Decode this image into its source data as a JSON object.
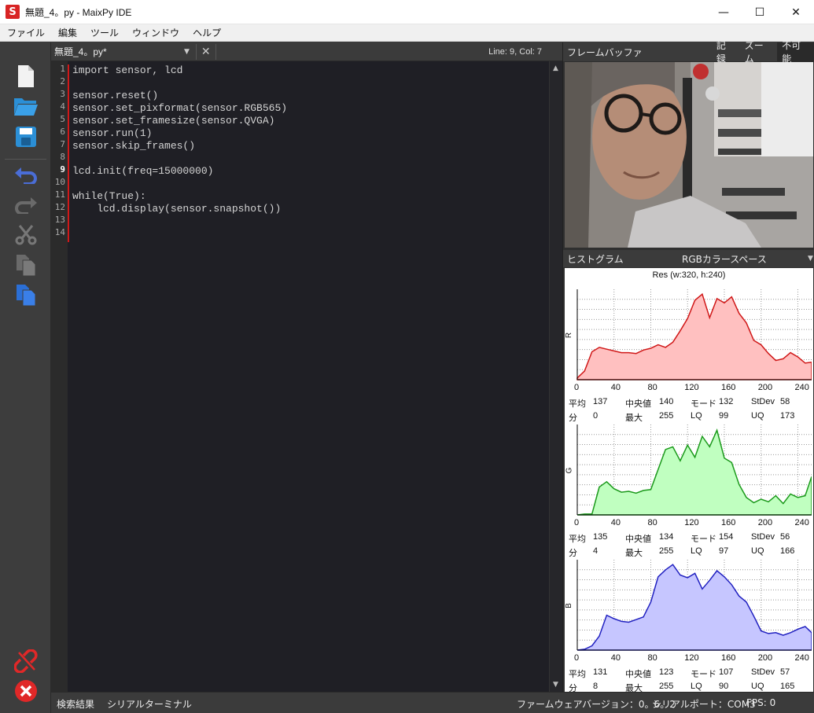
{
  "window": {
    "title": "無題_4。py - MaixPy IDE",
    "app_icon": "S",
    "minimize": "—",
    "maximize": "☐",
    "close": "✕"
  },
  "menu": [
    "ファイル",
    "編集",
    "ツール",
    "ウィンドウ",
    "ヘルプ"
  ],
  "toolbar": {
    "icons": [
      "new-file-icon",
      "open-folder-icon",
      "save-icon",
      "undo-icon",
      "redo-icon",
      "cut-icon",
      "copy-icon",
      "paste-icon",
      "disconnect-icon",
      "stop-icon"
    ]
  },
  "editor": {
    "tab_name": "無題_4。py*",
    "cursor_position": "Line: 9, Col: 7",
    "active_line": 9,
    "lines": [
      "import sensor, lcd",
      "",
      "sensor.reset()",
      "sensor.set_pixformat(sensor.RGB565)",
      "sensor.set_framesize(sensor.QVGA)",
      "sensor.run(1)",
      "sensor.skip_frames()",
      "",
      "lcd.init(freq=15000000)",
      "",
      "while(True):",
      "    lcd.display(sensor.snapshot())",
      "",
      ""
    ]
  },
  "framebuffer": {
    "label": "フレームバッファ",
    "buttons": [
      "記録",
      "ズーム",
      "不可能"
    ],
    "active_button": "不可能"
  },
  "histogram": {
    "label": "ヒストグラム",
    "color_space": "RGBカラースペース",
    "resolution": "Res (w:320, h:240)",
    "x_ticks": [
      "0",
      "40",
      "80",
      "120",
      "160",
      "200",
      "240"
    ],
    "stat_labels": {
      "mean": "平均",
      "median": "中央値",
      "mode": "モード",
      "stdev": "StDev",
      "min": "分",
      "max": "最大",
      "lq": "LQ",
      "uq": "UQ"
    },
    "channels": [
      {
        "name": "R",
        "color": "#ffc0c0",
        "stroke": "#d01818",
        "mean": "137",
        "median": "140",
        "mode": "132",
        "stdev": "58",
        "min": "0",
        "max": "255",
        "lq": "99",
        "uq": "173"
      },
      {
        "name": "G",
        "color": "#c0ffc0",
        "stroke": "#1a9a1a",
        "mean": "135",
        "median": "134",
        "mode": "154",
        "stdev": "56",
        "min": "4",
        "max": "255",
        "lq": "97",
        "uq": "166"
      },
      {
        "name": "B",
        "color": "#c6c6ff",
        "stroke": "#2020c0",
        "mean": "131",
        "median": "123",
        "mode": "107",
        "stdev": "57",
        "min": "8",
        "max": "255",
        "lq": "90",
        "uq": "165"
      }
    ]
  },
  "chart_data": [
    {
      "type": "area",
      "ylabel": "R",
      "x": [
        0,
        8,
        16,
        24,
        32,
        40,
        48,
        56,
        64,
        72,
        80,
        88,
        96,
        104,
        112,
        120,
        128,
        136,
        144,
        152,
        160,
        168,
        176,
        184,
        192,
        200,
        208,
        216,
        224,
        232,
        240,
        248,
        255
      ],
      "y": [
        2,
        10,
        32,
        37,
        35,
        33,
        31,
        31,
        30,
        34,
        36,
        40,
        37,
        43,
        56,
        70,
        91,
        98,
        71,
        93,
        88,
        95,
        76,
        65,
        45,
        40,
        30,
        22,
        24,
        31,
        26,
        19,
        20
      ]
    },
    {
      "type": "area",
      "ylabel": "G",
      "x": [
        0,
        8,
        16,
        24,
        32,
        40,
        48,
        56,
        64,
        72,
        80,
        88,
        96,
        104,
        112,
        120,
        128,
        136,
        144,
        152,
        160,
        168,
        176,
        184,
        192,
        200,
        208,
        216,
        224,
        232,
        240,
        248,
        255
      ],
      "y": [
        0,
        1,
        1,
        32,
        38,
        30,
        26,
        27,
        25,
        28,
        29,
        52,
        75,
        78,
        62,
        80,
        66,
        90,
        78,
        97,
        65,
        60,
        35,
        20,
        14,
        18,
        15,
        22,
        13,
        24,
        20,
        22,
        44
      ]
    },
    {
      "type": "area",
      "ylabel": "B",
      "x": [
        0,
        8,
        16,
        24,
        32,
        40,
        48,
        56,
        64,
        72,
        80,
        88,
        96,
        104,
        112,
        120,
        128,
        136,
        144,
        152,
        160,
        168,
        176,
        184,
        192,
        200,
        208,
        216,
        224,
        232,
        240,
        248,
        255
      ],
      "y": [
        0,
        1,
        5,
        16,
        40,
        36,
        33,
        32,
        35,
        38,
        55,
        84,
        92,
        98,
        86,
        83,
        88,
        70,
        80,
        91,
        84,
        75,
        62,
        55,
        39,
        22,
        19,
        20,
        17,
        20,
        24,
        27,
        20
      ]
    }
  ],
  "statusbar": {
    "search_results": "検索結果",
    "serial_terminal": "シリアルターミナル",
    "firmware": "ファームウェアバージョン：0。6。2",
    "serial_port": "シリアルポート：COM3",
    "fps": "FPS: 0"
  }
}
